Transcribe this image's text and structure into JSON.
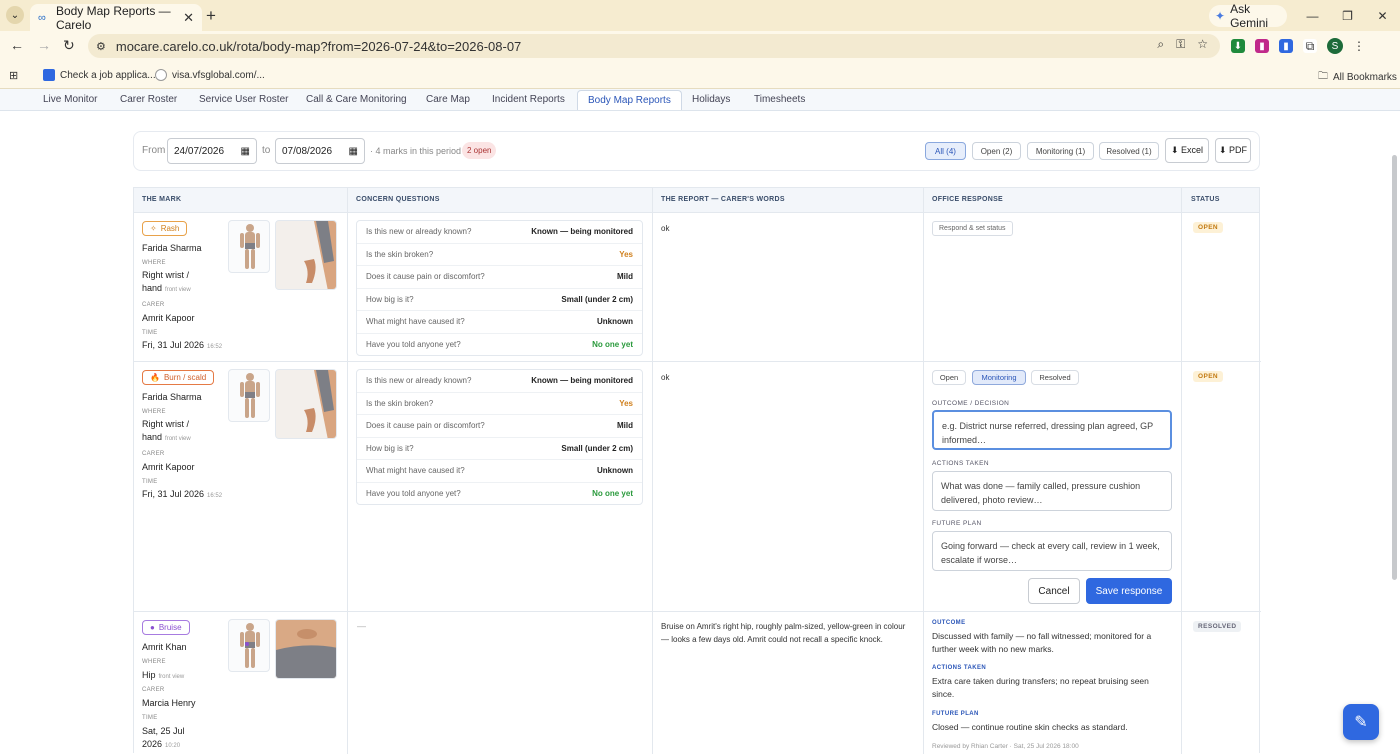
{
  "browser": {
    "tab_title": "Body Map Reports — Carelo",
    "gemini_label": "Ask Gemini",
    "url": "mocare.carelo.co.uk/rota/body-map?from=2026-07-24&to=2026-08-07",
    "profile_initial": "S",
    "bookmarks": [
      "Check a job applica...",
      "visa.vfsglobal.com/..."
    ],
    "all_bookmarks": "All Bookmarks"
  },
  "nav": {
    "tabs": [
      "Live Monitor",
      "Carer Roster",
      "Service User Roster",
      "Call & Care Monitoring",
      "Care Map",
      "Incident Reports",
      "Body Map Reports",
      "Holidays",
      "Timesheets"
    ],
    "active": "Body Map Reports"
  },
  "filter": {
    "from_label": "From",
    "from_date": "24/07/2026",
    "to_label": "to",
    "to_date": "07/08/2026",
    "marks_text": "· 4 marks in this period",
    "open_badge": "2 open",
    "pills": [
      "All (4)",
      "Open (2)",
      "Monitoring (1)",
      "Resolved (1)"
    ],
    "excel": "⬇ Excel",
    "pdf": "⬇ PDF"
  },
  "table": {
    "headers": [
      "THE MARK",
      "CONCERN QUESTIONS",
      "THE REPORT — CARER'S WORDS",
      "OFFICE RESPONSE",
      "STATUS"
    ],
    "labels": {
      "where": "WHERE",
      "carer": "CARER",
      "time": "TIME"
    },
    "rows": [
      {
        "type": "Rash",
        "type_icon": "sparkle-icon",
        "name": "Farida Sharma",
        "where": "Right wrist / hand",
        "view": "front view",
        "carer": "Amrit Kapoor",
        "date": "Fri, 31 Jul 2026",
        "time": "16:52",
        "questions": [
          {
            "q": "Is this new or already known?",
            "a": "Known — being monitored"
          },
          {
            "q": "Is the skin broken?",
            "a": "Yes"
          },
          {
            "q": "Does it cause pain or discomfort?",
            "a": "Mild"
          },
          {
            "q": "How big is it?",
            "a": "Small (under 2 cm)"
          },
          {
            "q": "What might have caused it?",
            "a": "Unknown"
          },
          {
            "q": "Have you told anyone yet?",
            "a": "No one yet"
          }
        ],
        "report": "ok",
        "respond_button": "Respond & set status",
        "status": "OPEN"
      },
      {
        "type": "Burn / scald",
        "type_icon": "flame-icon",
        "name": "Farida Sharma",
        "where": "Right wrist / hand",
        "view": "front view",
        "carer": "Amrit Kapoor",
        "date": "Fri, 31 Jul 2026",
        "time": "16:52",
        "questions": [
          {
            "q": "Is this new or already known?",
            "a": "Known — being monitored"
          },
          {
            "q": "Is the skin broken?",
            "a": "Yes"
          },
          {
            "q": "Does it cause pain or discomfort?",
            "a": "Mild"
          },
          {
            "q": "How big is it?",
            "a": "Small (under 2 cm)"
          },
          {
            "q": "What might have caused it?",
            "a": "Unknown"
          },
          {
            "q": "Have you told anyone yet?",
            "a": "No one yet"
          }
        ],
        "report": "ok",
        "response_form": {
          "status_options": [
            "Open",
            "Monitoring",
            "Resolved"
          ],
          "selected": "Monitoring",
          "outcome_label": "OUTCOME / DECISION",
          "outcome_placeholder": "e.g. District nurse referred, dressing plan agreed, GP informed…",
          "actions_label": "ACTIONS TAKEN",
          "actions_placeholder": "What was done — family called, pressure cushion delivered, photo review…",
          "plan_label": "FUTURE PLAN",
          "plan_placeholder": "Going forward — check at every call, review in 1 week, escalate if worse…",
          "cancel": "Cancel",
          "save": "Save response"
        },
        "status": "OPEN"
      },
      {
        "type": "Bruise",
        "type_icon": "dot-icon",
        "name": "Amrit Khan",
        "where": "Hip",
        "view": "front view",
        "carer": "Marcia Henry",
        "date": "Sat, 25 Jul 2026",
        "time": "10:20",
        "questions_empty": "—",
        "report": "Bruise on Amrit's right hip, roughly palm-sized, yellow-green in colour — looks a few days old. Amrit could not recall a specific knock.",
        "response": {
          "outcome_label": "OUTCOME",
          "outcome": "Discussed with family — no fall witnessed; monitored for a further week with no new marks.",
          "actions_label": "ACTIONS TAKEN",
          "actions": "Extra care taken during transfers; no repeat bruising seen since.",
          "plan_label": "FUTURE PLAN",
          "plan": "Closed — continue routine skin checks as standard.",
          "reviewed": "Reviewed by Rhian Carter · Sat, 25 Jul 2026 18:00"
        },
        "status": "RESOLVED"
      }
    ]
  },
  "colors": {
    "accent": "#2f68e0",
    "open": "#c27a12",
    "rash": "#e08a2a",
    "burn": "#e0602a",
    "bruise": "#8a4fd0"
  }
}
